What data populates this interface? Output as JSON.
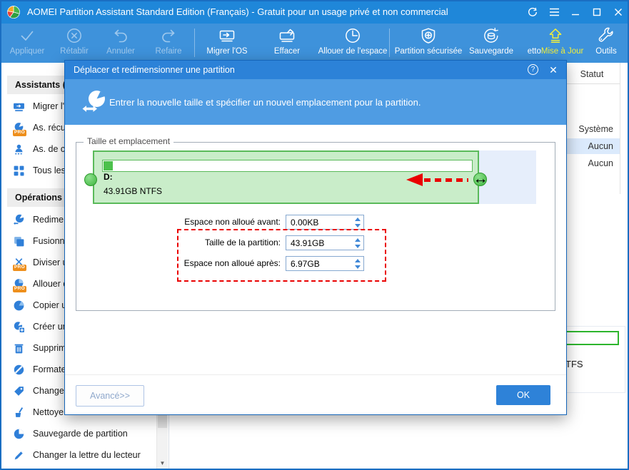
{
  "titlebar": {
    "title": "AOMEI Partition Assistant Standard Edition (Français) - Gratuit pour un usage privé et non commercial"
  },
  "toolbar": {
    "appliquer": "Appliquer",
    "retablir": "Rétablir",
    "annuler": "Annuler",
    "refaire": "Refaire",
    "migrer": "Migrer l'OS",
    "effacer": "Effacer",
    "allouer": "Allouer de l'espace",
    "securisee": "Partition sécurisée",
    "sauvegarde": "Sauvegarde",
    "netto_fragment": "etto",
    "mise_a_jour": "Mise à Jour",
    "outils": "Outils"
  },
  "sidebar": {
    "assistants_header": "Assistants (",
    "operations_header": "Opérations s",
    "assistants_items": [
      "Migrer l'O",
      "As. récu",
      "As. de c",
      "Tous les"
    ],
    "operations_items": [
      "Redimen",
      "Fusionne",
      "Diviser u",
      "Allouer d",
      "Copier u",
      "Créer un",
      "Supprime",
      "Formate",
      "Changer",
      "Nettoye",
      "Sauvegarde de partition",
      "Changer la lettre du lecteur"
    ],
    "pro_badge": "PRO",
    "scroll_down_glyph": "▼"
  },
  "main": {
    "statut_header": "Statut",
    "status_rows": [
      "Système",
      "Aucun",
      "Aucun"
    ],
    "disk_text_fragment": "TFS"
  },
  "dialog": {
    "title": "Déplacer et redimensionner une partition",
    "help_glyph": "?",
    "close_glyph": "✕",
    "banner_text": "Entrer la nouvelle taille et spécifier un nouvel emplacement pour la partition.",
    "groupbox_label": "Taille et emplacement",
    "partition_name": "D:",
    "partition_size": "43.91GB NTFS",
    "resize_cursor_glyph": "↔",
    "fields": [
      {
        "label": "Espace non alloué avant:",
        "value": "0.00KB"
      },
      {
        "label": "Taille de la partition:",
        "value": "43.91GB"
      },
      {
        "label": "Espace non alloué après:",
        "value": "6.97GB"
      }
    ],
    "advanced_button": "Avancé>>",
    "ok_button": "OK"
  },
  "colors": {
    "titlebar_blue": "#1f87d9",
    "toolbar_blue": "#3e92db",
    "dialog_title_blue": "#2c82d8",
    "banner_blue": "#4f9ce3",
    "accent_blue": "#2e82d8",
    "partition_green": "#5aba5a",
    "annotation_red": "#ea0000",
    "update_yellow": "#f1ee3b",
    "pro_orange": "#ee8f1c"
  }
}
